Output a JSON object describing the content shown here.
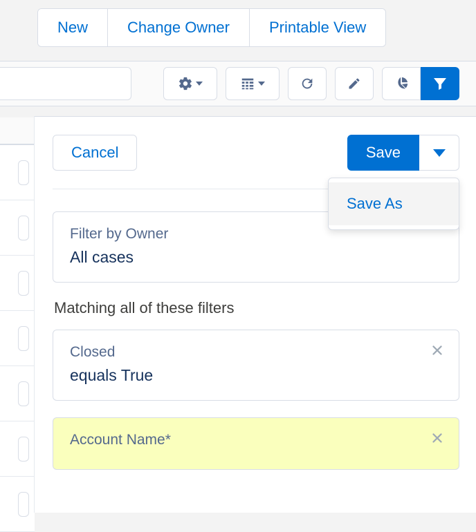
{
  "topActions": {
    "new": "New",
    "changeOwner": "Change Owner",
    "printableView": "Printable View"
  },
  "panel": {
    "cancel": "Cancel",
    "save": "Save",
    "saveAs": "Save As"
  },
  "ownerFilter": {
    "label": "Filter by Owner",
    "value": "All cases"
  },
  "matchingHeading": "Matching all of these filters",
  "filters": [
    {
      "field": "Closed",
      "condition": "equals  True"
    },
    {
      "field": "Account Name*",
      "condition": ""
    }
  ]
}
